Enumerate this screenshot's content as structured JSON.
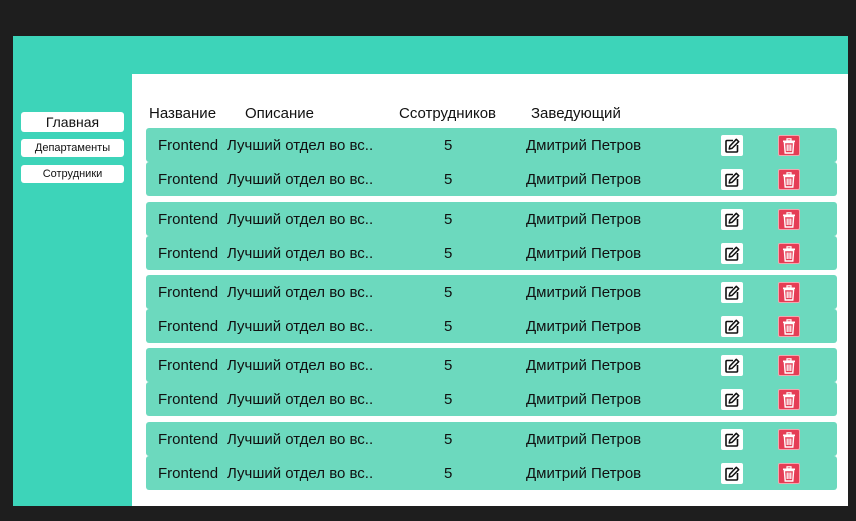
{
  "sidebar": {
    "items": [
      {
        "label": "Главная"
      },
      {
        "label": "Департаменты"
      },
      {
        "label": "Сотрудники"
      }
    ]
  },
  "table": {
    "headers": {
      "name": "Название",
      "description": "Описание",
      "employees": "Ссотрудников",
      "head": "Заведующий"
    },
    "rows": [
      {
        "name": "Frontend",
        "description": "Лучший отдел во вс..",
        "employees": "5",
        "head": "Дмитрий Петров"
      },
      {
        "name": "Frontend",
        "description": "Лучший отдел во вс..",
        "employees": "5",
        "head": "Дмитрий Петров"
      },
      {
        "name": "Frontend",
        "description": "Лучший отдел во вс..",
        "employees": "5",
        "head": "Дмитрий Петров"
      },
      {
        "name": "Frontend",
        "description": "Лучший отдел во вс..",
        "employees": "5",
        "head": "Дмитрий Петров"
      },
      {
        "name": "Frontend",
        "description": "Лучший отдел во вс..",
        "employees": "5",
        "head": "Дмитрий Петров"
      },
      {
        "name": "Frontend",
        "description": "Лучший отдел во вс..",
        "employees": "5",
        "head": "Дмитрий Петров"
      },
      {
        "name": "Frontend",
        "description": "Лучший отдел во вс..",
        "employees": "5",
        "head": "Дмитрий Петров"
      },
      {
        "name": "Frontend",
        "description": "Лучший отдел во вс..",
        "employees": "5",
        "head": "Дмитрий Петров"
      },
      {
        "name": "Frontend",
        "description": "Лучший отдел во вс..",
        "employees": "5",
        "head": "Дмитрий Петров"
      },
      {
        "name": "Frontend",
        "description": "Лучший отдел во вс..",
        "employees": "5",
        "head": "Дмитрий Петров"
      }
    ]
  },
  "icons": {
    "edit": "edit-icon",
    "delete": "trash-icon"
  },
  "colors": {
    "accent": "#3dd4b9",
    "row": "#6cd9be",
    "delete": "#e53d55",
    "background": "#1e1e1e"
  }
}
